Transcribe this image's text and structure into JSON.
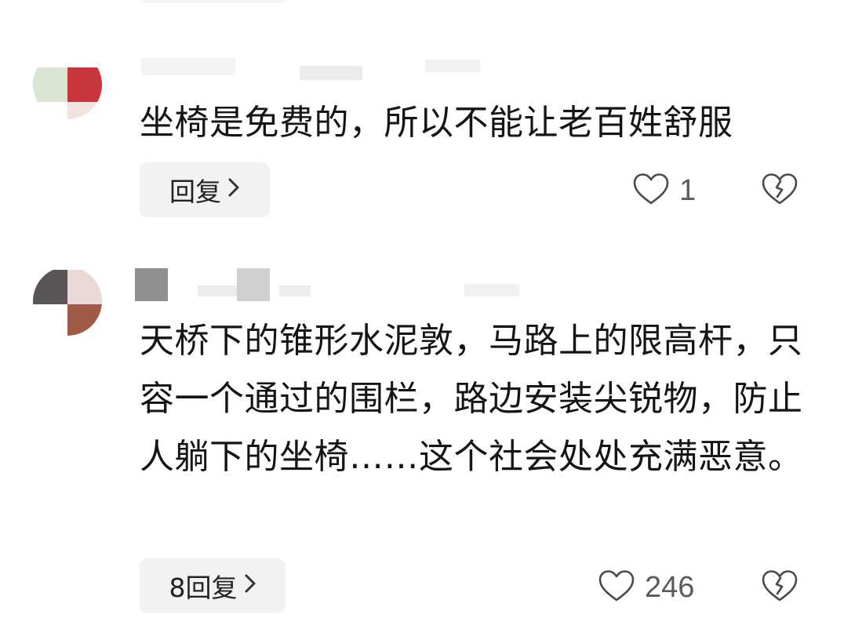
{
  "comments": [
    {
      "text": "坐椅是免费的，所以不能让老百姓舒服",
      "reply_label": "回复",
      "like_count": "1",
      "avatar_colors": [
        "#d8e6d2",
        "#c8363b",
        "#f3e3e0"
      ],
      "icons": {
        "like": "heart-outline-icon",
        "dislike": "broken-heart-icon",
        "reply_chevron": "chevron-right-icon"
      }
    },
    {
      "text": "天桥下的锥形水泥敦，马路上的限高杆，只容一个通过的围栏，路边安装尖锐物，防止人躺下的坐椅……这个社会处处充满恶意。",
      "reply_label": "8回复",
      "like_count": "246",
      "avatar_colors": [
        "#5a5657",
        "#e8d8d6",
        "#a05a45"
      ],
      "icons": {
        "like": "heart-outline-icon",
        "dislike": "broken-heart-icon",
        "reply_chevron": "chevron-right-icon"
      }
    }
  ],
  "colors": {
    "text": "#151515",
    "count": "#5b5b5b",
    "button_bg": "#f1f2f4",
    "icon_stroke": "#3c3c3c"
  }
}
